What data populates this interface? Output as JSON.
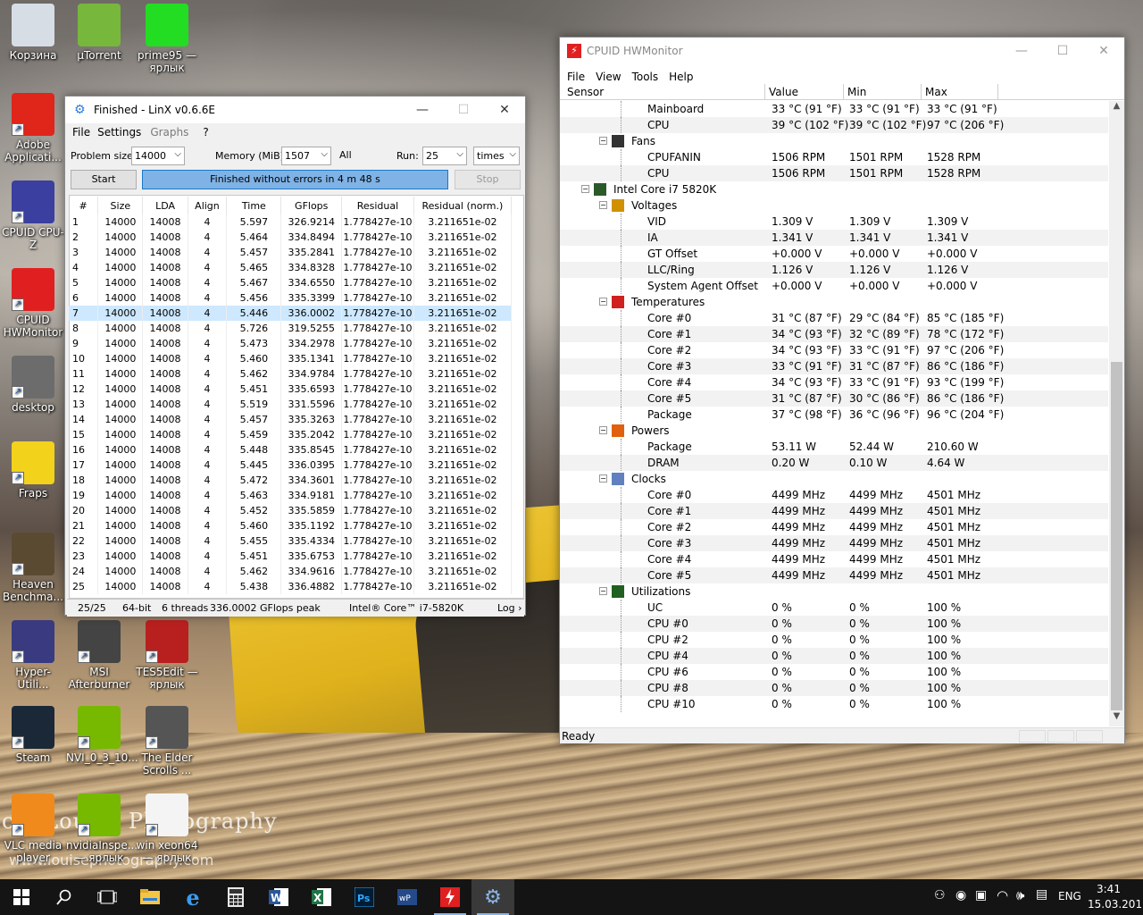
{
  "desktop": {
    "icons": [
      {
        "label": "Корзина",
        "icon": "recycle-bin-icon"
      },
      {
        "label": "µTorrent",
        "icon": "utorrent-icon"
      },
      {
        "label": "prime95 — ярлык",
        "icon": "prime95-icon"
      },
      {
        "label": "Adobe Applicati...",
        "icon": "adobe-icon"
      },
      {
        "label": "CPUID CPU-Z",
        "icon": "cpuz-icon"
      },
      {
        "label": "CPUID HWMonitor",
        "icon": "hwmonitor-icon"
      },
      {
        "label": "desktop",
        "icon": "folder-icon"
      },
      {
        "label": "Fraps",
        "icon": "fraps-icon"
      },
      {
        "label": "Heaven Benchma...",
        "icon": "heaven-icon"
      },
      {
        "label": "Hyper-Utili...",
        "icon": "hyper-icon"
      },
      {
        "label": "MSI Afterburner",
        "icon": "afterburner-icon"
      },
      {
        "label": "TES5Edit — ярлык",
        "icon": "tes5edit-icon"
      },
      {
        "label": "Steam",
        "icon": "steam-icon"
      },
      {
        "label": "NVI_0_3_10...",
        "icon": "nvidia-icon"
      },
      {
        "label": "The Elder Scrolls ...",
        "icon": "skyrim-icon"
      },
      {
        "label": "VLC media player",
        "icon": "vlc-icon"
      },
      {
        "label": "nvidiaInspe... — ярлык",
        "icon": "nvidia-inspector-icon"
      },
      {
        "label": "win xeon64 — ярлык",
        "icon": "file-icon"
      }
    ],
    "watermark": "cio Louise Photography",
    "watermark2": "www.louisephotography.com"
  },
  "linx": {
    "title": "Finished - LinX v0.6.6E",
    "menu": [
      "File",
      "Settings",
      "Graphs",
      "?"
    ],
    "problem_label": "Problem size:",
    "problem_value": "14000",
    "memory_label": "Memory (MiB):",
    "memory_value": "1507",
    "all_label": "All",
    "run_label": "Run:",
    "run_value": "25",
    "times_value": "times",
    "start_label": "Start",
    "status": "Finished without errors in 4 m 48 s",
    "stop_label": "Stop",
    "columns": [
      "#",
      "Size",
      "LDA",
      "Align",
      "Time",
      "GFlops",
      "Residual",
      "Residual (norm.)"
    ],
    "rows": [
      [
        "1",
        "14000",
        "14008",
        "4",
        "5.597",
        "326.9214",
        "1.778427e-10",
        "3.211651e-02"
      ],
      [
        "2",
        "14000",
        "14008",
        "4",
        "5.464",
        "334.8494",
        "1.778427e-10",
        "3.211651e-02"
      ],
      [
        "3",
        "14000",
        "14008",
        "4",
        "5.457",
        "335.2841",
        "1.778427e-10",
        "3.211651e-02"
      ],
      [
        "4",
        "14000",
        "14008",
        "4",
        "5.465",
        "334.8328",
        "1.778427e-10",
        "3.211651e-02"
      ],
      [
        "5",
        "14000",
        "14008",
        "4",
        "5.467",
        "334.6550",
        "1.778427e-10",
        "3.211651e-02"
      ],
      [
        "6",
        "14000",
        "14008",
        "4",
        "5.456",
        "335.3399",
        "1.778427e-10",
        "3.211651e-02"
      ],
      [
        "7",
        "14000",
        "14008",
        "4",
        "5.446",
        "336.0002",
        "1.778427e-10",
        "3.211651e-02"
      ],
      [
        "8",
        "14000",
        "14008",
        "4",
        "5.726",
        "319.5255",
        "1.778427e-10",
        "3.211651e-02"
      ],
      [
        "9",
        "14000",
        "14008",
        "4",
        "5.473",
        "334.2978",
        "1.778427e-10",
        "3.211651e-02"
      ],
      [
        "10",
        "14000",
        "14008",
        "4",
        "5.460",
        "335.1341",
        "1.778427e-10",
        "3.211651e-02"
      ],
      [
        "11",
        "14000",
        "14008",
        "4",
        "5.462",
        "334.9784",
        "1.778427e-10",
        "3.211651e-02"
      ],
      [
        "12",
        "14000",
        "14008",
        "4",
        "5.451",
        "335.6593",
        "1.778427e-10",
        "3.211651e-02"
      ],
      [
        "13",
        "14000",
        "14008",
        "4",
        "5.519",
        "331.5596",
        "1.778427e-10",
        "3.211651e-02"
      ],
      [
        "14",
        "14000",
        "14008",
        "4",
        "5.457",
        "335.3263",
        "1.778427e-10",
        "3.211651e-02"
      ],
      [
        "15",
        "14000",
        "14008",
        "4",
        "5.459",
        "335.2042",
        "1.778427e-10",
        "3.211651e-02"
      ],
      [
        "16",
        "14000",
        "14008",
        "4",
        "5.448",
        "335.8545",
        "1.778427e-10",
        "3.211651e-02"
      ],
      [
        "17",
        "14000",
        "14008",
        "4",
        "5.445",
        "336.0395",
        "1.778427e-10",
        "3.211651e-02"
      ],
      [
        "18",
        "14000",
        "14008",
        "4",
        "5.472",
        "334.3601",
        "1.778427e-10",
        "3.211651e-02"
      ],
      [
        "19",
        "14000",
        "14008",
        "4",
        "5.463",
        "334.9181",
        "1.778427e-10",
        "3.211651e-02"
      ],
      [
        "20",
        "14000",
        "14008",
        "4",
        "5.452",
        "335.5859",
        "1.778427e-10",
        "3.211651e-02"
      ],
      [
        "21",
        "14000",
        "14008",
        "4",
        "5.460",
        "335.1192",
        "1.778427e-10",
        "3.211651e-02"
      ],
      [
        "22",
        "14000",
        "14008",
        "4",
        "5.455",
        "335.4334",
        "1.778427e-10",
        "3.211651e-02"
      ],
      [
        "23",
        "14000",
        "14008",
        "4",
        "5.451",
        "335.6753",
        "1.778427e-10",
        "3.211651e-02"
      ],
      [
        "24",
        "14000",
        "14008",
        "4",
        "5.462",
        "334.9616",
        "1.778427e-10",
        "3.211651e-02"
      ],
      [
        "25",
        "14000",
        "14008",
        "4",
        "5.438",
        "336.4882",
        "1.778427e-10",
        "3.211651e-02"
      ]
    ],
    "selected_row": 7,
    "statusbar": {
      "runs": "25/25",
      "bits": "64-bit",
      "threads": "6 threads",
      "peak": "336.0002 GFlops peak",
      "cpu": "Intel® Core™ i7-5820K",
      "log": "Log ›"
    }
  },
  "hwmonitor": {
    "title": "CPUID HWMonitor",
    "menu": [
      "File",
      "View",
      "Tools",
      "Help"
    ],
    "columns": [
      "Sensor",
      "Value",
      "Min",
      "Max"
    ],
    "status": "Ready",
    "rows": [
      {
        "type": "item",
        "label": "Mainboard",
        "v": "33 °C  (91 °F)",
        "min": "33 °C  (91 °F)",
        "max": "33 °C  (91 °F)"
      },
      {
        "type": "item",
        "label": "CPU",
        "v": "39 °C  (102 °F)",
        "min": "39 °C  (102 °F)",
        "max": "97 °C  (206 °F)"
      },
      {
        "type": "group",
        "label": "Fans",
        "icon": "fan-icon"
      },
      {
        "type": "item",
        "label": "CPUFANIN",
        "v": "1506 RPM",
        "min": "1501 RPM",
        "max": "1528 RPM"
      },
      {
        "type": "item",
        "label": "CPU",
        "v": "1506 RPM",
        "min": "1501 RPM",
        "max": "1528 RPM"
      },
      {
        "type": "device",
        "label": "Intel Core i7 5820K",
        "icon": "chip-icon"
      },
      {
        "type": "group",
        "label": "Voltages",
        "icon": "voltage-icon"
      },
      {
        "type": "item",
        "label": "VID",
        "v": "1.309 V",
        "min": "1.309 V",
        "max": "1.309 V"
      },
      {
        "type": "item",
        "label": "IA",
        "v": "1.341 V",
        "min": "1.341 V",
        "max": "1.341 V"
      },
      {
        "type": "item",
        "label": "GT Offset",
        "v": "+0.000 V",
        "min": "+0.000 V",
        "max": "+0.000 V"
      },
      {
        "type": "item",
        "label": "LLC/Ring",
        "v": "1.126 V",
        "min": "1.126 V",
        "max": "1.126 V"
      },
      {
        "type": "item",
        "label": "System Agent Offset",
        "v": "+0.000 V",
        "min": "+0.000 V",
        "max": "+0.000 V"
      },
      {
        "type": "group",
        "label": "Temperatures",
        "icon": "thermometer-icon"
      },
      {
        "type": "item",
        "label": "Core #0",
        "v": "31 °C  (87 °F)",
        "min": "29 °C  (84 °F)",
        "max": "85 °C  (185 °F)"
      },
      {
        "type": "item",
        "label": "Core #1",
        "v": "34 °C  (93 °F)",
        "min": "32 °C  (89 °F)",
        "max": "78 °C  (172 °F)"
      },
      {
        "type": "item",
        "label": "Core #2",
        "v": "34 °C  (93 °F)",
        "min": "33 °C  (91 °F)",
        "max": "97 °C  (206 °F)"
      },
      {
        "type": "item",
        "label": "Core #3",
        "v": "33 °C  (91 °F)",
        "min": "31 °C  (87 °F)",
        "max": "86 °C  (186 °F)"
      },
      {
        "type": "item",
        "label": "Core #4",
        "v": "34 °C  (93 °F)",
        "min": "33 °C  (91 °F)",
        "max": "93 °C  (199 °F)"
      },
      {
        "type": "item",
        "label": "Core #5",
        "v": "31 °C  (87 °F)",
        "min": "30 °C  (86 °F)",
        "max": "86 °C  (186 °F)"
      },
      {
        "type": "item",
        "label": "Package",
        "v": "37 °C  (98 °F)",
        "min": "36 °C  (96 °F)",
        "max": "96 °C  (204 °F)"
      },
      {
        "type": "group",
        "label": "Powers",
        "icon": "power-icon"
      },
      {
        "type": "item",
        "label": "Package",
        "v": "53.11 W",
        "min": "52.44 W",
        "max": "210.60 W"
      },
      {
        "type": "item",
        "label": "DRAM",
        "v": "0.20 W",
        "min": "0.10 W",
        "max": "4.64 W"
      },
      {
        "type": "group",
        "label": "Clocks",
        "icon": "clock-icon"
      },
      {
        "type": "item",
        "label": "Core #0",
        "v": "4499 MHz",
        "min": "4499 MHz",
        "max": "4501 MHz"
      },
      {
        "type": "item",
        "label": "Core #1",
        "v": "4499 MHz",
        "min": "4499 MHz",
        "max": "4501 MHz"
      },
      {
        "type": "item",
        "label": "Core #2",
        "v": "4499 MHz",
        "min": "4499 MHz",
        "max": "4501 MHz"
      },
      {
        "type": "item",
        "label": "Core #3",
        "v": "4499 MHz",
        "min": "4499 MHz",
        "max": "4501 MHz"
      },
      {
        "type": "item",
        "label": "Core #4",
        "v": "4499 MHz",
        "min": "4499 MHz",
        "max": "4501 MHz"
      },
      {
        "type": "item",
        "label": "Core #5",
        "v": "4499 MHz",
        "min": "4499 MHz",
        "max": "4501 MHz"
      },
      {
        "type": "group",
        "label": "Utilizations",
        "icon": "utilization-icon"
      },
      {
        "type": "item",
        "label": "UC",
        "v": "0 %",
        "min": "0 %",
        "max": "100 %"
      },
      {
        "type": "item",
        "label": "CPU #0",
        "v": "0 %",
        "min": "0 %",
        "max": "100 %"
      },
      {
        "type": "item",
        "label": "CPU #2",
        "v": "0 %",
        "min": "0 %",
        "max": "100 %"
      },
      {
        "type": "item",
        "label": "CPU #4",
        "v": "0 %",
        "min": "0 %",
        "max": "100 %"
      },
      {
        "type": "item",
        "label": "CPU #6",
        "v": "0 %",
        "min": "0 %",
        "max": "100 %"
      },
      {
        "type": "item",
        "label": "CPU #8",
        "v": "0 %",
        "min": "0 %",
        "max": "100 %"
      },
      {
        "type": "item",
        "label": "CPU #10",
        "v": "0 %",
        "min": "0 %",
        "max": "100 %"
      }
    ]
  },
  "taskbar": {
    "items": [
      "start-icon",
      "search-icon",
      "task-view-icon",
      "file-explorer-icon",
      "edge-icon",
      "calculator-icon",
      "word-icon",
      "excel-icon",
      "photoshop-icon",
      "wprime-icon",
      "hwmonitor-icon",
      "linx-icon"
    ],
    "lang": "ENG",
    "time": "3:41",
    "date": "15.03.2016"
  },
  "colors": {
    "accent": "#1979ca",
    "status_fill": "#7fb2e5",
    "selected_row": "#cde8ff",
    "hw_red": "#e02020"
  }
}
